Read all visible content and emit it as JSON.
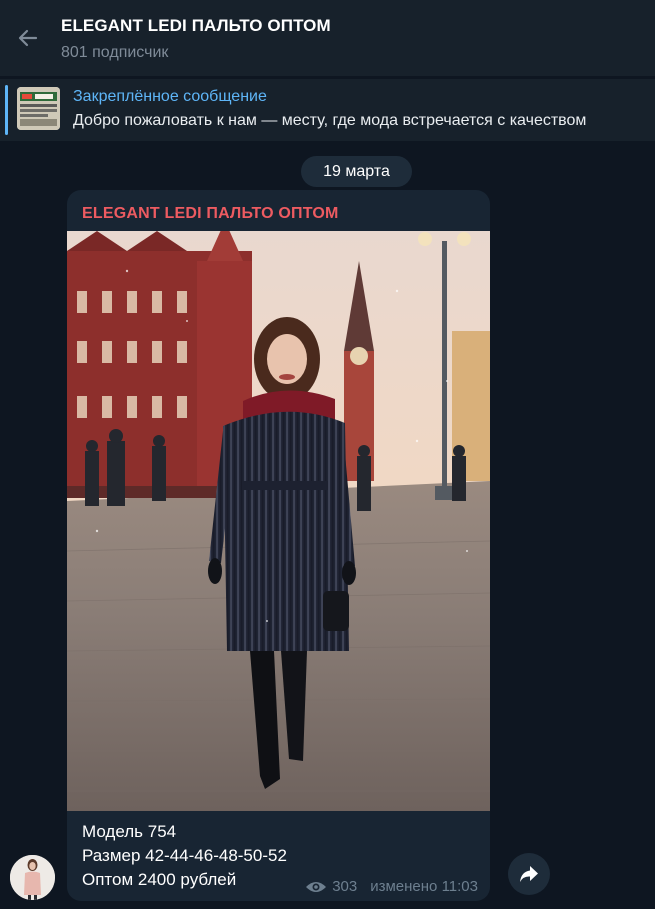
{
  "header": {
    "title": "ELEGANT LEDI ПАЛЬТО ОПТОМ",
    "subscribers": "801 подписчик",
    "back_icon": "arrow-left-icon"
  },
  "pinned": {
    "label": "Закреплённое сообщение",
    "text": "Добро пожаловать к нам — месту, где мода встречается с качеством",
    "accent": "#5eb5f7"
  },
  "date_chip": "19 марта",
  "message": {
    "author": "ELEGANT LEDI ПАЛЬТО ОПТОМ",
    "author_color": "#ed5b61",
    "caption_lines": [
      "Модель 754",
      "Размер 42-44-46-48-50-52",
      "Оптом 2400 рублей"
    ],
    "views": "303",
    "edited_time": "изменено 11:03"
  },
  "colors": {
    "background": "#0e1621",
    "header_bg": "#17212b",
    "bubble_bg": "#182533",
    "meta_text": "#6d7f8f"
  }
}
